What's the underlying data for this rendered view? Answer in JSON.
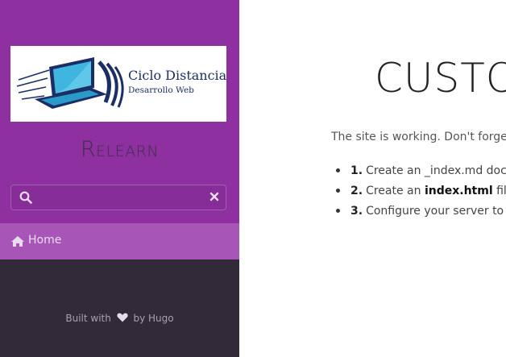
{
  "sidebar": {
    "logo": {
      "title": "Ciclo Distancia",
      "subtitle": "Desarrollo Web",
      "icon": "laptop-logo"
    },
    "site_name": "Relearn",
    "search": {
      "placeholder": "",
      "value": "",
      "icon": "search-icon",
      "clear_icon": "close-icon"
    },
    "menu": [
      {
        "label": "Home",
        "icon": "home-icon",
        "active": true
      }
    ],
    "footer": {
      "prefix": "Built with",
      "icon": "heart-icon",
      "suffix": "by Hugo"
    }
  },
  "main": {
    "title": "CUSTOM HOME PAGE",
    "intro": "The site is working. Don't forget to customize this homepage with your own. You typically have 3 choices :",
    "steps": [
      {
        "num": "1.",
        "text": "Create an _index.md document in content folder and fill it with Markdown content"
      },
      {
        "num": "2.",
        "text_before": "Create an ",
        "bold": "index.html",
        "text_after": " file in the static folder and fill the file with HTML content"
      },
      {
        "num": "3.",
        "text": "Configure your server to automatically redirect home page to one your documentation page"
      }
    ]
  },
  "colors": {
    "sidebar_header": "#8f30a1",
    "sidebar_body": "#322a38",
    "menu_active": "#a855b8",
    "logo_navy": "#1b2f66",
    "logo_cyan": "#2aa8d8"
  }
}
